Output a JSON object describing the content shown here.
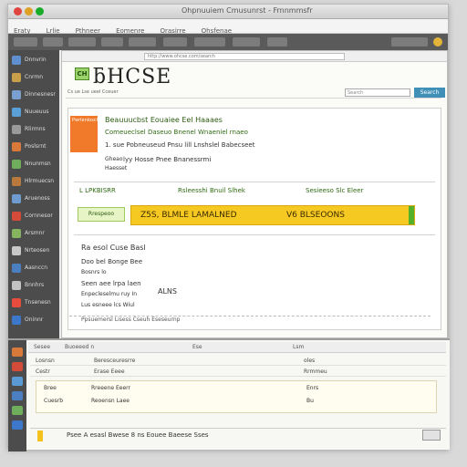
{
  "window": {
    "title": "Ohpnuuiem Cmusunrst - Frnnmmsfr"
  },
  "menubar": [
    "Eraty",
    "Lrlie",
    "Pthneer",
    "Eomenre",
    "Orasirre",
    "Ohsfenae"
  ],
  "dock": {
    "items": [
      {
        "label": "Dnnvrin",
        "color": "#5f8fcf"
      },
      {
        "label": "Cnrmn",
        "color": "#c9a04a"
      },
      {
        "label": "Dinnesnesr",
        "color": "#7a9fd1"
      },
      {
        "label": "Nuueuus",
        "color": "#5aa0d8"
      },
      {
        "label": "Rlirmns",
        "color": "#9a9a9a"
      },
      {
        "label": "Poslsrnt",
        "color": "#d97a3b"
      },
      {
        "label": "Nnunmsn",
        "color": "#6fae5c"
      },
      {
        "label": "Hlrmuecsn",
        "color": "#b9793c"
      },
      {
        "label": "Aruenoss",
        "color": "#6e9bd0"
      },
      {
        "label": "Cornnesor",
        "color": "#d44b3a"
      },
      {
        "label": "Arsmnr",
        "color": "#87b45f"
      },
      {
        "label": "Nrteosen",
        "color": "#c8c8c8"
      },
      {
        "label": "Aasnccn",
        "color": "#4b7fc2"
      },
      {
        "label": "Bnnhrs",
        "color": "#c2c2c2"
      },
      {
        "label": "Tnsenesn",
        "color": "#e84c3d"
      },
      {
        "label": "Oninnr",
        "color": "#3d77c9"
      }
    ]
  },
  "browser": {
    "address": "http://www.ohcse.com/search",
    "logo_mark": "CH",
    "brand": "ƃHCSE",
    "breadcrumb": "Cs ue Lse ueel  Cceuer",
    "search_placeholder": "Search",
    "search_button": "Search"
  },
  "result": {
    "badge": "Pwrlenlosch",
    "heading": "Beauuucbst Eouaiee Eel Haaaes",
    "line1": "Comeueclsel  Daseuo  Bnenel  Wnaeniel rnaeo",
    "line2": "1. sue  Pobneuseud  Pnsu  lill  Lnshslel Babecseet",
    "line3a": "Gheao",
    "line3b": "lyy  Hosse  Pnee  Bnanessrmi",
    "line4": "Haesset",
    "section_title": "L  LPKBISRR",
    "section_mid": "Rsleesshi  Bnuil  Slhek",
    "section_right": "Sesieeso  Slc  Eleer",
    "hl_label": "Rrespeoo",
    "hl_text": "Z5S, BLMLE LAMALNED",
    "hl_text2": "V6  BLSEOONS",
    "list": [
      "Ra  esol  Cuse  Basl",
      "Doo  bel  Bonge  Bee",
      "Bosnrs  lo",
      "Seen  aee  lrpa  laen",
      "Enpecleselmu  ruy  In",
      "Lus  esneee  lcs  Wiul",
      "ALNS"
    ],
    "footer_note": "Ppsuemersl  Lisess  Cseuh  Eseseurnp"
  },
  "bottom": {
    "tabs": [
      "Sesee",
      "Buoeeed  n",
      "Ese",
      "Lsm"
    ],
    "rows": [
      {
        "a": "Losnsn",
        "b": "Beresceuresrre",
        "c": "oles"
      },
      {
        "a": "Cestr",
        "b": "Erase  Eeee",
        "c": "Rrmmeu"
      },
      {
        "a": "Bree",
        "b": "Rreeene  Eeerr",
        "c": "Enrs"
      },
      {
        "a": "Cuesrb",
        "b": "Reoensn  Laee",
        "c": "Bu"
      }
    ],
    "footer_text": "Psee  A  esasl  Bwese  8  ns  Eouee  Baeese  Sses"
  },
  "colors": {
    "accent_green": "#2f6b12",
    "highlight_yellow": "#f6c922",
    "badge_orange": "#f07a2a",
    "search_blue": "#3f8fb7"
  }
}
